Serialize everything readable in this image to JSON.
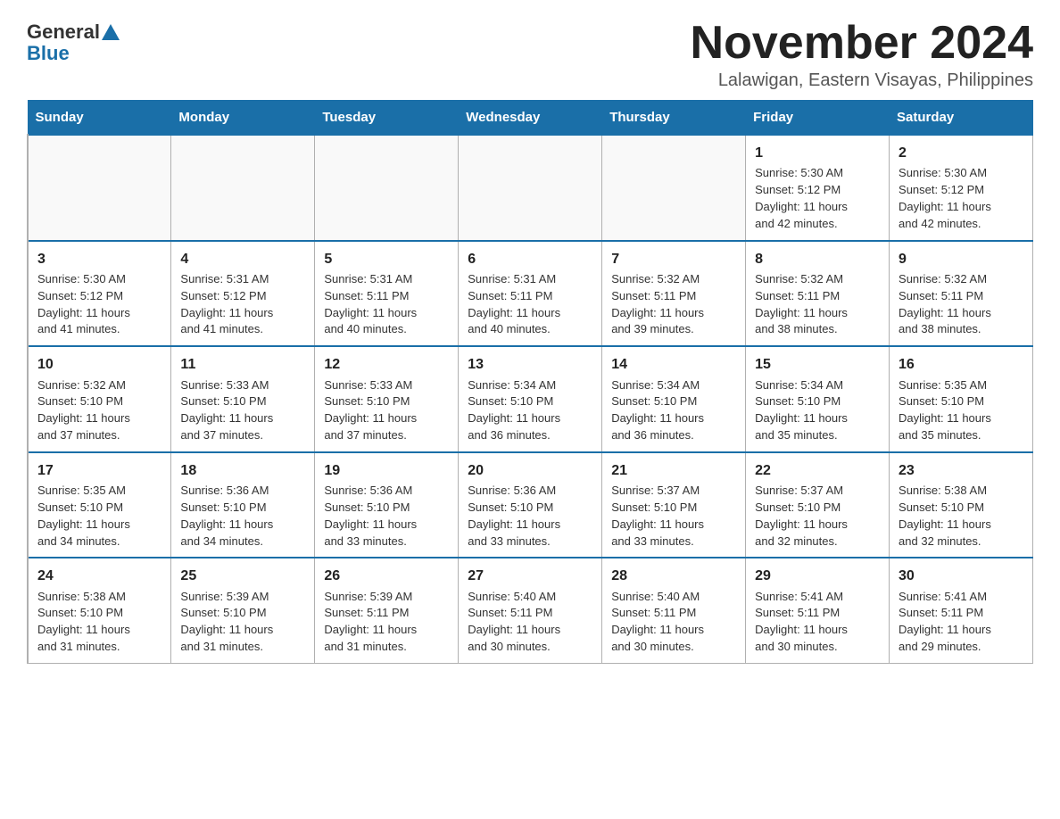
{
  "logo": {
    "general": "General",
    "blue": "Blue"
  },
  "title": "November 2024",
  "location": "Lalawigan, Eastern Visayas, Philippines",
  "days_of_week": [
    "Sunday",
    "Monday",
    "Tuesday",
    "Wednesday",
    "Thursday",
    "Friday",
    "Saturday"
  ],
  "weeks": [
    [
      {
        "day": "",
        "info": ""
      },
      {
        "day": "",
        "info": ""
      },
      {
        "day": "",
        "info": ""
      },
      {
        "day": "",
        "info": ""
      },
      {
        "day": "",
        "info": ""
      },
      {
        "day": "1",
        "info": "Sunrise: 5:30 AM\nSunset: 5:12 PM\nDaylight: 11 hours\nand 42 minutes."
      },
      {
        "day": "2",
        "info": "Sunrise: 5:30 AM\nSunset: 5:12 PM\nDaylight: 11 hours\nand 42 minutes."
      }
    ],
    [
      {
        "day": "3",
        "info": "Sunrise: 5:30 AM\nSunset: 5:12 PM\nDaylight: 11 hours\nand 41 minutes."
      },
      {
        "day": "4",
        "info": "Sunrise: 5:31 AM\nSunset: 5:12 PM\nDaylight: 11 hours\nand 41 minutes."
      },
      {
        "day": "5",
        "info": "Sunrise: 5:31 AM\nSunset: 5:11 PM\nDaylight: 11 hours\nand 40 minutes."
      },
      {
        "day": "6",
        "info": "Sunrise: 5:31 AM\nSunset: 5:11 PM\nDaylight: 11 hours\nand 40 minutes."
      },
      {
        "day": "7",
        "info": "Sunrise: 5:32 AM\nSunset: 5:11 PM\nDaylight: 11 hours\nand 39 minutes."
      },
      {
        "day": "8",
        "info": "Sunrise: 5:32 AM\nSunset: 5:11 PM\nDaylight: 11 hours\nand 38 minutes."
      },
      {
        "day": "9",
        "info": "Sunrise: 5:32 AM\nSunset: 5:11 PM\nDaylight: 11 hours\nand 38 minutes."
      }
    ],
    [
      {
        "day": "10",
        "info": "Sunrise: 5:32 AM\nSunset: 5:10 PM\nDaylight: 11 hours\nand 37 minutes."
      },
      {
        "day": "11",
        "info": "Sunrise: 5:33 AM\nSunset: 5:10 PM\nDaylight: 11 hours\nand 37 minutes."
      },
      {
        "day": "12",
        "info": "Sunrise: 5:33 AM\nSunset: 5:10 PM\nDaylight: 11 hours\nand 37 minutes."
      },
      {
        "day": "13",
        "info": "Sunrise: 5:34 AM\nSunset: 5:10 PM\nDaylight: 11 hours\nand 36 minutes."
      },
      {
        "day": "14",
        "info": "Sunrise: 5:34 AM\nSunset: 5:10 PM\nDaylight: 11 hours\nand 36 minutes."
      },
      {
        "day": "15",
        "info": "Sunrise: 5:34 AM\nSunset: 5:10 PM\nDaylight: 11 hours\nand 35 minutes."
      },
      {
        "day": "16",
        "info": "Sunrise: 5:35 AM\nSunset: 5:10 PM\nDaylight: 11 hours\nand 35 minutes."
      }
    ],
    [
      {
        "day": "17",
        "info": "Sunrise: 5:35 AM\nSunset: 5:10 PM\nDaylight: 11 hours\nand 34 minutes."
      },
      {
        "day": "18",
        "info": "Sunrise: 5:36 AM\nSunset: 5:10 PM\nDaylight: 11 hours\nand 34 minutes."
      },
      {
        "day": "19",
        "info": "Sunrise: 5:36 AM\nSunset: 5:10 PM\nDaylight: 11 hours\nand 33 minutes."
      },
      {
        "day": "20",
        "info": "Sunrise: 5:36 AM\nSunset: 5:10 PM\nDaylight: 11 hours\nand 33 minutes."
      },
      {
        "day": "21",
        "info": "Sunrise: 5:37 AM\nSunset: 5:10 PM\nDaylight: 11 hours\nand 33 minutes."
      },
      {
        "day": "22",
        "info": "Sunrise: 5:37 AM\nSunset: 5:10 PM\nDaylight: 11 hours\nand 32 minutes."
      },
      {
        "day": "23",
        "info": "Sunrise: 5:38 AM\nSunset: 5:10 PM\nDaylight: 11 hours\nand 32 minutes."
      }
    ],
    [
      {
        "day": "24",
        "info": "Sunrise: 5:38 AM\nSunset: 5:10 PM\nDaylight: 11 hours\nand 31 minutes."
      },
      {
        "day": "25",
        "info": "Sunrise: 5:39 AM\nSunset: 5:10 PM\nDaylight: 11 hours\nand 31 minutes."
      },
      {
        "day": "26",
        "info": "Sunrise: 5:39 AM\nSunset: 5:11 PM\nDaylight: 11 hours\nand 31 minutes."
      },
      {
        "day": "27",
        "info": "Sunrise: 5:40 AM\nSunset: 5:11 PM\nDaylight: 11 hours\nand 30 minutes."
      },
      {
        "day": "28",
        "info": "Sunrise: 5:40 AM\nSunset: 5:11 PM\nDaylight: 11 hours\nand 30 minutes."
      },
      {
        "day": "29",
        "info": "Sunrise: 5:41 AM\nSunset: 5:11 PM\nDaylight: 11 hours\nand 30 minutes."
      },
      {
        "day": "30",
        "info": "Sunrise: 5:41 AM\nSunset: 5:11 PM\nDaylight: 11 hours\nand 29 minutes."
      }
    ]
  ]
}
